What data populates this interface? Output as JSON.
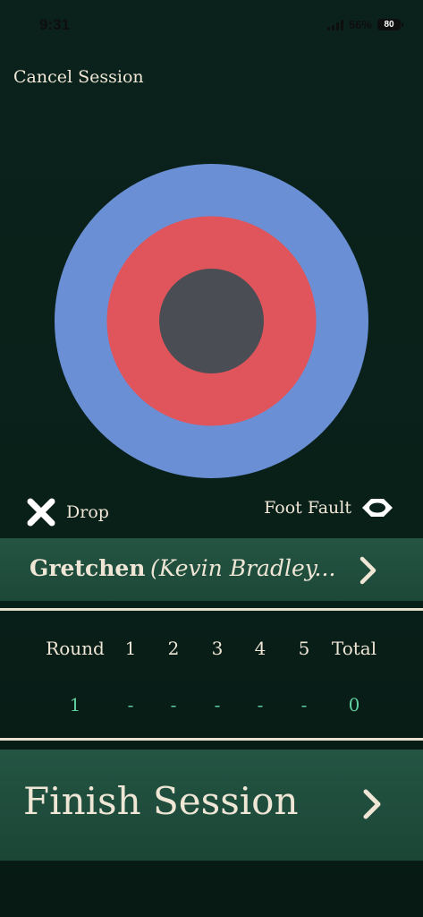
{
  "status_bar": {
    "time": "9:31",
    "battery_percent": "56%",
    "battery_level": "80"
  },
  "header": {
    "cancel_label": "Cancel Session"
  },
  "target": {
    "outer_color": "#6b8fd4",
    "middle_color": "#e0545c",
    "inner_color": "#4a4e54"
  },
  "controls": {
    "drop_label": "Drop",
    "drop_icon": "x-icon",
    "foot_fault_label": "Foot Fault",
    "foot_fault_icon": "eye-icon"
  },
  "player": {
    "name": "Gretchen",
    "partner": "(Kevin Bradley..."
  },
  "scoreboard": {
    "headers": [
      "Round",
      "1",
      "2",
      "3",
      "4",
      "5",
      "Total"
    ],
    "values": [
      "1",
      "-",
      "-",
      "-",
      "-",
      "-",
      "0"
    ]
  },
  "finish": {
    "label": "Finish Session"
  }
}
